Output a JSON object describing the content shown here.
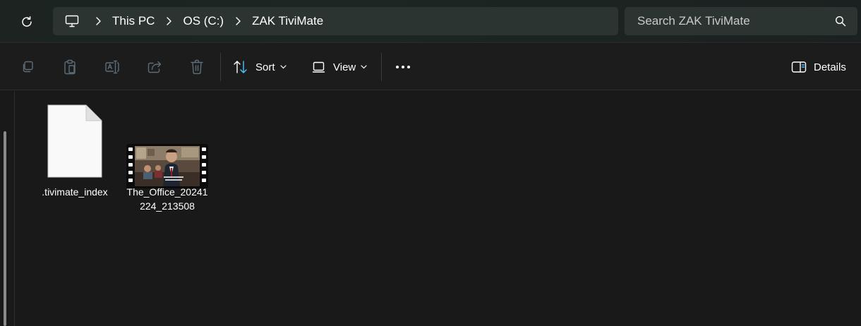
{
  "address": {
    "breadcrumbs": [
      "This PC",
      "OS (C:)",
      "ZAK TiviMate"
    ]
  },
  "search": {
    "placeholder": "Search ZAK TiviMate"
  },
  "toolbar": {
    "sort_label": "Sort",
    "view_label": "View",
    "details_label": "Details"
  },
  "files": [
    {
      "name": ".tivimate_index",
      "type": "generic-file"
    },
    {
      "name": "The_Office_20241224_213508",
      "display_line1": "The_Office_20241",
      "display_line2": "224_213508",
      "type": "video"
    }
  ],
  "colors": {
    "accent": "#4cc2ff",
    "disabled_icon": "#5d6e78",
    "background": "#191919"
  }
}
